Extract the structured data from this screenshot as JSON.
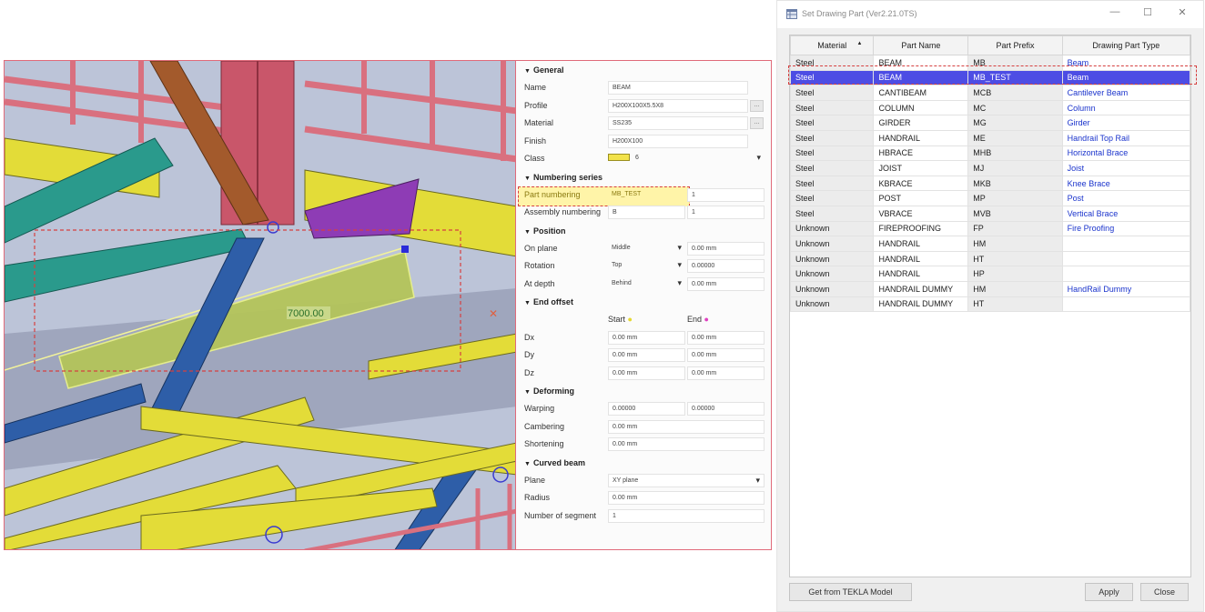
{
  "properties": {
    "general": {
      "header": "General",
      "name_label": "Name",
      "name_value": "BEAM",
      "profile_label": "Profile",
      "profile_value": "H200X100X5.5X8",
      "material_label": "Material",
      "material_value": "SS235",
      "finish_label": "Finish",
      "finish_value": "H200X100",
      "class_label": "Class",
      "class_value": "6",
      "class_color": "#f2e24a"
    },
    "numbering": {
      "header": "Numbering series",
      "part_label": "Part numbering",
      "part_prefix": "MB_TEST",
      "part_start": "1",
      "assembly_label": "Assembly numbering",
      "assembly_prefix": "B",
      "assembly_start": "1"
    },
    "position": {
      "header": "Position",
      "on_plane_label": "On plane",
      "on_plane_value": "Middle",
      "on_plane_offset": "0.00 mm",
      "rotation_label": "Rotation",
      "rotation_value": "Top",
      "rotation_offset": "0.00000",
      "at_depth_label": "At depth",
      "at_depth_value": "Behind",
      "at_depth_offset": "0.00 mm"
    },
    "end_offset": {
      "header": "End offset",
      "start_label": "Start",
      "end_label": "End",
      "dx_label": "Dx",
      "dx_start": "0.00 mm",
      "dx_end": "0.00 mm",
      "dy_label": "Dy",
      "dy_start": "0.00 mm",
      "dy_end": "0.00 mm",
      "dz_label": "Dz",
      "dz_start": "0.00 mm",
      "dz_end": "0.00 mm"
    },
    "deforming": {
      "header": "Deforming",
      "warping_label": "Warping",
      "warping_start": "0.00000",
      "warping_end": "0.00000",
      "cambering_label": "Cambering",
      "cambering_value": "0.00 mm",
      "shortening_label": "Shortening",
      "shortening_value": "0.00 mm"
    },
    "curved_beam": {
      "header": "Curved beam",
      "plane_label": "Plane",
      "plane_value": "XY plane",
      "radius_label": "Radius",
      "radius_value": "0.00 mm",
      "segments_label": "Number of segment",
      "segments_value": "1"
    }
  },
  "viewport": {
    "dimension_label": "7000.00"
  },
  "dialog": {
    "title": "Set Drawing Part (Ver2.21.0TS)",
    "columns": [
      "Material",
      "Part Name",
      "Part Prefix",
      "Drawing Part Type"
    ],
    "rows": [
      {
        "material": "Steel",
        "name": "BEAM",
        "prefix": "MB",
        "type": "Beam"
      },
      {
        "material": "Steel",
        "name": "BEAM",
        "prefix": "MB_TEST",
        "type": "Beam"
      },
      {
        "material": "Steel",
        "name": "CANTIBEAM",
        "prefix": "MCB",
        "type": "Cantilever Beam"
      },
      {
        "material": "Steel",
        "name": "COLUMN",
        "prefix": "MC",
        "type": "Column"
      },
      {
        "material": "Steel",
        "name": "GIRDER",
        "prefix": "MG",
        "type": "Girder"
      },
      {
        "material": "Steel",
        "name": "HANDRAIL",
        "prefix": "ME",
        "type": "Handrail Top Rail"
      },
      {
        "material": "Steel",
        "name": "HBRACE",
        "prefix": "MHB",
        "type": "Horizontal Brace"
      },
      {
        "material": "Steel",
        "name": "JOIST",
        "prefix": "MJ",
        "type": "Joist"
      },
      {
        "material": "Steel",
        "name": "KBRACE",
        "prefix": "MKB",
        "type": "Knee Brace"
      },
      {
        "material": "Steel",
        "name": "POST",
        "prefix": "MP",
        "type": "Post"
      },
      {
        "material": "Steel",
        "name": "VBRACE",
        "prefix": "MVB",
        "type": "Vertical Brace"
      },
      {
        "material": "Unknown",
        "name": "FIREPROOFING",
        "prefix": "FP",
        "type": "Fire Proofing"
      },
      {
        "material": "Unknown",
        "name": "HANDRAIL",
        "prefix": "HM",
        "type": ""
      },
      {
        "material": "Unknown",
        "name": "HANDRAIL",
        "prefix": "HT",
        "type": ""
      },
      {
        "material": "Unknown",
        "name": "HANDRAIL",
        "prefix": "HP",
        "type": ""
      },
      {
        "material": "Unknown",
        "name": "HANDRAIL DUMMY",
        "prefix": "HM",
        "type": "HandRail Dummy"
      },
      {
        "material": "Unknown",
        "name": "HANDRAIL DUMMY",
        "prefix": "HT",
        "type": ""
      }
    ],
    "selected_row": 1,
    "sort_indicator": "▲",
    "get_button": "Get from TEKLA Model",
    "apply_button": "Apply",
    "close_button": "Close",
    "min_glyph": "—",
    "max_glyph": "☐",
    "close_glyph": "✕"
  }
}
